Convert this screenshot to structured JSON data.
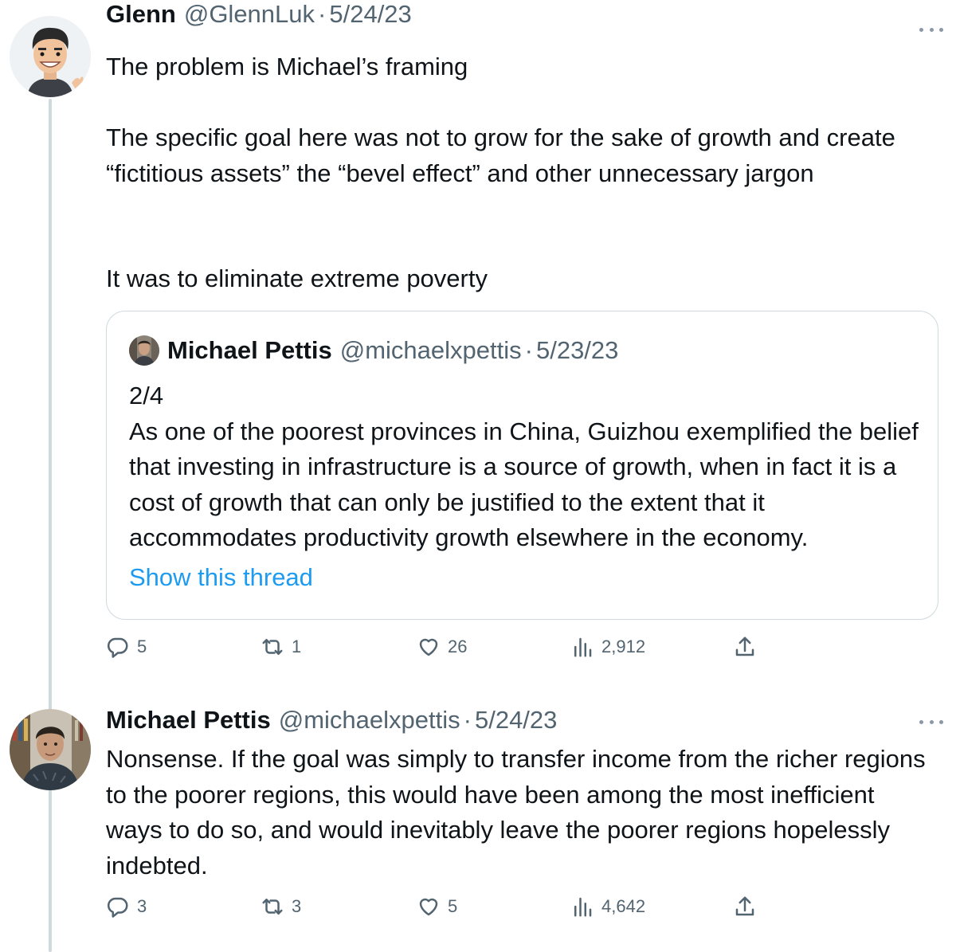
{
  "tweet1": {
    "name": "Glenn",
    "handle": "@GlennLuk",
    "date": "5/24/23",
    "paragraphs": [
      "The problem is Michael’s framing",
      "The specific goal here was not to grow for the sake of growth and create “fictitious assets” the “bevel effect” and other unnecessary jargon",
      "It was to eliminate extreme poverty"
    ],
    "quote": {
      "name": "Michael Pettis",
      "handle": "@michaelxpettis",
      "date": "5/23/23",
      "line1": "2/4",
      "text": "As one of the poorest provinces in China, Guizhou exemplified the belief that investing in infrastructure is a source of growth, when in fact it is a cost of growth that can only be justified to the extent that it accommodates productivity growth elsewhere in the economy.",
      "show_thread": "Show this thread"
    },
    "actions": {
      "replies": "5",
      "retweets": "1",
      "likes": "26",
      "views": "2,912"
    }
  },
  "tweet2": {
    "name": "Michael Pettis",
    "handle": "@michaelxpettis",
    "date": "5/24/23",
    "text": "Nonsense. If the goal was simply to transfer income from the richer regions to the poorer regions, this would have been among the most inefficient ways to do so, and would inevitably leave the poorer regions hopelessly indebted.",
    "actions": {
      "replies": "3",
      "retweets": "3",
      "likes": "5",
      "views": "4,642"
    }
  },
  "separator": "·",
  "icons": [
    "reply-icon",
    "retweet-icon",
    "like-icon",
    "views-icon",
    "share-icon",
    "more-icon"
  ],
  "colors": {
    "text": "#0f1419",
    "muted": "#536471",
    "link": "#1d9bf0",
    "border": "#cfd9de"
  }
}
